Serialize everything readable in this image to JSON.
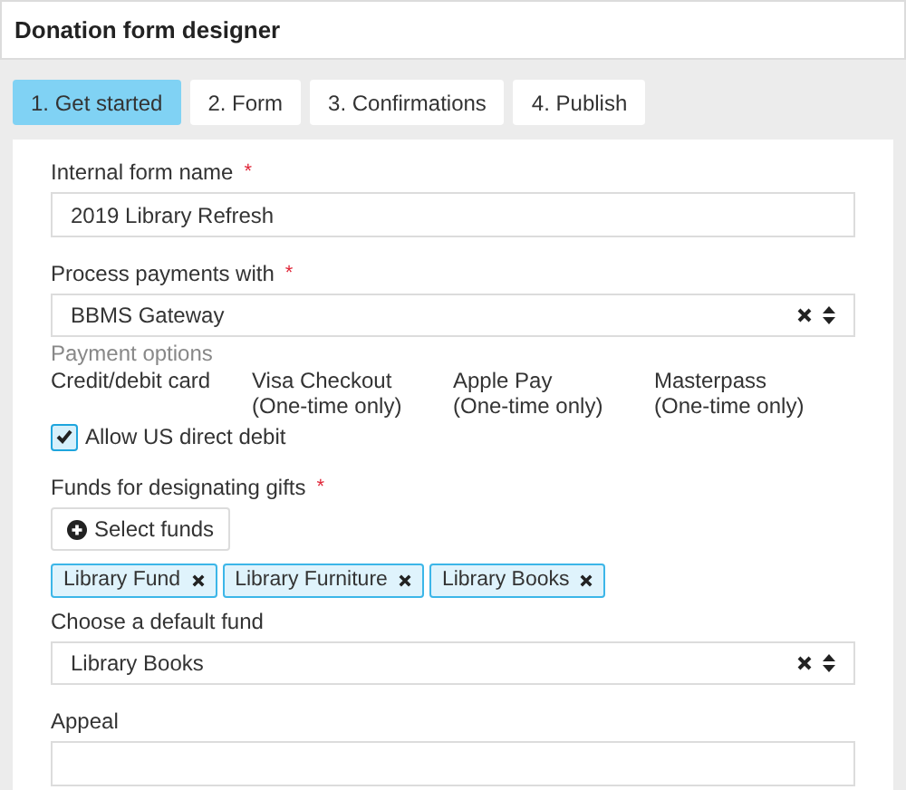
{
  "window": {
    "title": "Donation form designer"
  },
  "tabs": [
    {
      "label": "1. Get started",
      "selected": true
    },
    {
      "label": "2. Form",
      "selected": false
    },
    {
      "label": "3. Confirmations",
      "selected": false
    },
    {
      "label": "4. Publish",
      "selected": false
    }
  ],
  "form_name": {
    "label": "Internal form name",
    "required_mark": "*",
    "value": "2019 Library Refresh"
  },
  "payments": {
    "label": "Process payments with",
    "required_mark": "*",
    "value": "BBMS Gateway",
    "options_heading": "Payment options",
    "options": [
      {
        "name": "Credit/debit card"
      },
      {
        "name": "Visa Checkout",
        "note": "(One-time only)"
      },
      {
        "name": "Apple Pay",
        "note": "(One-time only)"
      },
      {
        "name": "Masterpass",
        "note": "(One-time only)"
      }
    ],
    "direct_debit": {
      "label": "Allow US direct debit",
      "checked": true
    }
  },
  "funds": {
    "label": "Funds for designating gifts",
    "required_mark": "*",
    "button": "Select funds",
    "tags": [
      {
        "label": "Library Fund"
      },
      {
        "label": "Library Furniture"
      },
      {
        "label": "Library Books"
      }
    ]
  },
  "default_fund": {
    "label": "Choose a default fund",
    "value": "Library Books"
  },
  "appeal": {
    "label": "Appeal"
  }
}
